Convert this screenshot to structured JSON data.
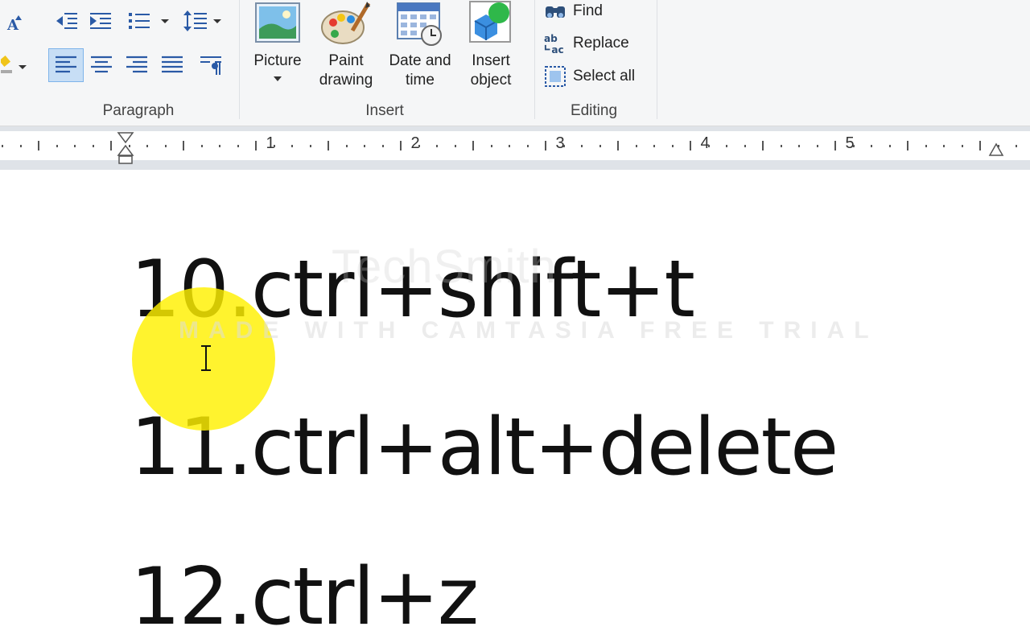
{
  "ribbon": {
    "paragraph": {
      "label": "Paragraph"
    },
    "insert": {
      "label": "Insert",
      "picture": "Picture",
      "paint_drawing_1": "Paint",
      "paint_drawing_2": "drawing",
      "date_time_1": "Date and",
      "date_time_2": "time",
      "insert_object_1": "Insert",
      "insert_object_2": "object"
    },
    "editing": {
      "label": "Editing",
      "find": "Find",
      "replace": "Replace",
      "select_all": "Select all"
    }
  },
  "ruler": {
    "numbers": [
      "1",
      "2",
      "3",
      "4",
      "5"
    ]
  },
  "document": {
    "lines": [
      "10.ctrl+shift+t",
      "11.ctrl+alt+delete",
      "12.ctrl+z"
    ]
  },
  "watermark": {
    "logo": "TechSmith",
    "text": "MADE WITH CAMTASIA FREE TRIAL"
  },
  "colors": {
    "ribbon_bg": "#f5f6f7",
    "highlight": "#fff000",
    "active_button": "#c7def5"
  }
}
